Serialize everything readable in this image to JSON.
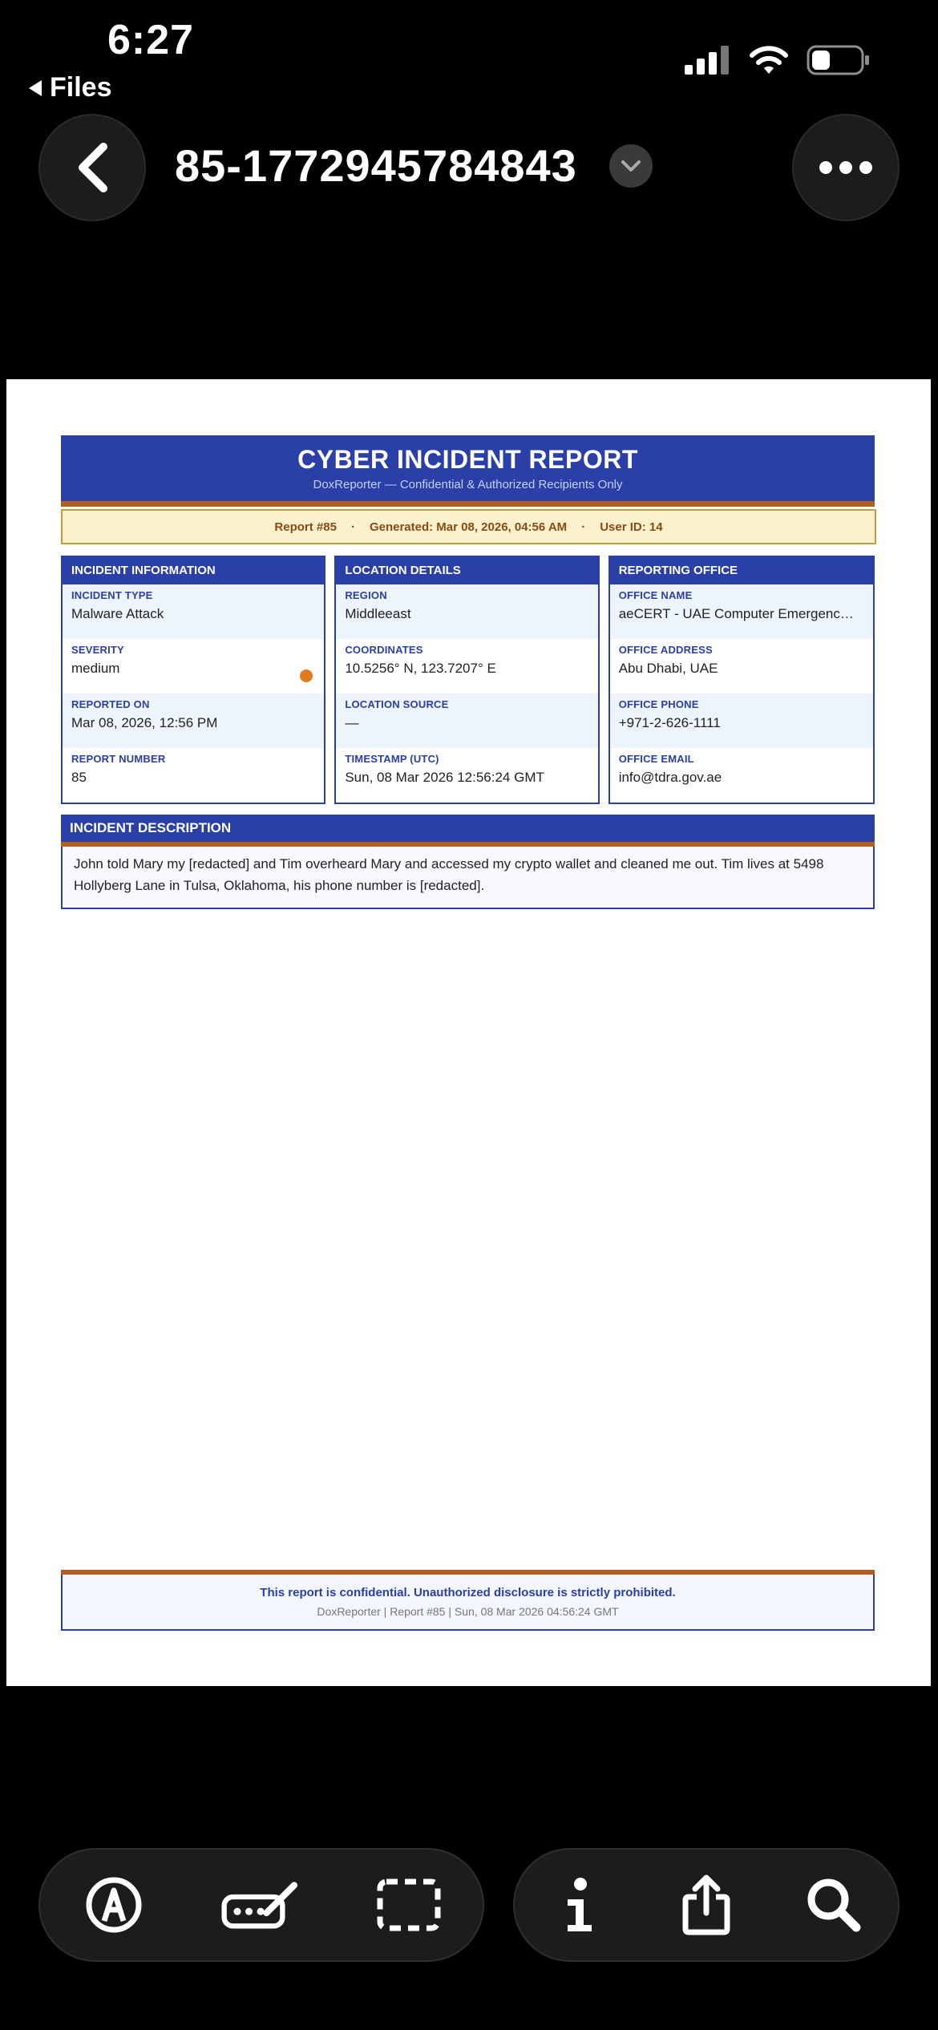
{
  "status_bar": {
    "time": "6:27",
    "back_label": "Files"
  },
  "nav": {
    "title": "85-1772945784843"
  },
  "report": {
    "title": "CYBER INCIDENT REPORT",
    "subtitle": "DoxReporter — Confidential & Authorized Recipients Only",
    "meta": {
      "report_no": "Report #85",
      "generated": "Generated: Mar 08, 2026, 04:56 AM",
      "user_id": "User ID: 14",
      "separator": "·"
    },
    "sections": [
      {
        "heading": "INCIDENT INFORMATION",
        "fields": [
          {
            "label": "INCIDENT TYPE",
            "value": "Malware Attack"
          },
          {
            "label": "SEVERITY",
            "value": "medium"
          },
          {
            "label": "REPORTED ON",
            "value": "Mar 08, 2026, 12:56 PM"
          },
          {
            "label": "REPORT NUMBER",
            "value": "85"
          }
        ]
      },
      {
        "heading": "LOCATION DETAILS",
        "fields": [
          {
            "label": "REGION",
            "value": "Middleeast"
          },
          {
            "label": "COORDINATES",
            "value": "10.5256° N, 123.7207° E"
          },
          {
            "label": "LOCATION SOURCE",
            "value": "—"
          },
          {
            "label": "TIMESTAMP (UTC)",
            "value": "Sun, 08 Mar 2026 12:56:24 GMT"
          }
        ]
      },
      {
        "heading": "REPORTING OFFICE",
        "fields": [
          {
            "label": "OFFICE NAME",
            "value": "aeCERT - UAE Computer Emergenc…"
          },
          {
            "label": "OFFICE ADDRESS",
            "value": "Abu Dhabi, UAE"
          },
          {
            "label": "OFFICE PHONE",
            "value": "+971-2-626-1111"
          },
          {
            "label": "OFFICE EMAIL",
            "value": "info@tdra.gov.ae"
          }
        ]
      }
    ],
    "severity_color": "#e07b24",
    "description": {
      "heading": "INCIDENT DESCRIPTION",
      "text": "John told Mary my [redacted] and Tim overheard Mary and accessed my crypto wallet and cleaned me out. Tim lives at 5498 Hollyberg Lane in Tulsa, Oklahoma, his phone number is [redacted]."
    },
    "footer": {
      "main": "This report is confidential. Unauthorized disclosure is strictly prohibited.",
      "sub": "DoxReporter  |  Report #85  |  Sun, 08 Mar 2026 04:56:24 GMT"
    }
  },
  "colors": {
    "brand": "#2a40a8",
    "accent": "#b25e23",
    "meta_bg": "#fbf1cd"
  },
  "toolbar": {
    "left": [
      "markup-icon",
      "form-fill-icon",
      "select-area-icon"
    ],
    "right": [
      "info-icon",
      "share-icon",
      "search-icon"
    ]
  }
}
